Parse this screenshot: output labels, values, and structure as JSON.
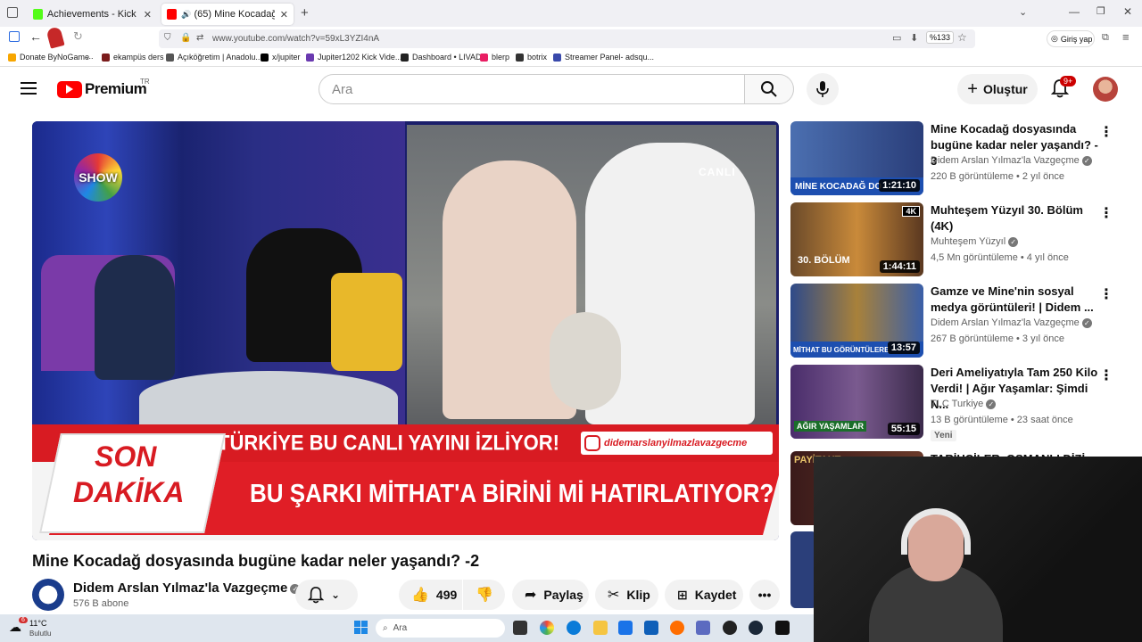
{
  "browser": {
    "tabs": [
      {
        "label": "Achievements - Kick Dashboard",
        "active": false
      },
      {
        "label": "(65) Mine Kocadağ dosyası",
        "active": true
      }
    ],
    "url": "www.youtube.com/watch?v=59xL3YZI4nA",
    "zoom": "%133",
    "signin": "Giriş yap",
    "bookmarks": [
      "Donate ByNoGame",
      "ekampüs ders",
      "Açıköğretim | Anadolu...",
      "x/jupiter",
      "Jupiter1202 Kick Vide...",
      "Dashboard • LIVAD",
      "blerp",
      "botrix",
      "Streamer Panel- adsqu..."
    ]
  },
  "youtube": {
    "logo": "Premium",
    "region": "TR",
    "search_placeholder": "Ara",
    "create_label": "Oluştur",
    "notifications": "9+"
  },
  "video": {
    "show_logo": "SHOW",
    "canli": "CANLI",
    "banner_left_1": "SON",
    "banner_left_2": "DAKİKA",
    "banner_top": "TÜRKİYE BU CANLI YAYINI İZLİYOR!",
    "banner_handle": "didemarslanyilmazlavazgecme",
    "banner_bottom": "BU ŞARKI MİTHAT'A BİRİNİ Mİ HATIRLATIYOR?",
    "title": "Mine Kocadağ dosyasında bugüne kadar neler yaşandı? -2",
    "channel": "Didem Arslan Yılmaz'la Vazgeçme",
    "subscribers": "576 B abone",
    "likes": "499",
    "share": "Paylaş",
    "clip": "Klip",
    "save": "Kaydet"
  },
  "recommendations": [
    {
      "title": "Mine Kocadağ dosyasında bugüne kadar neler yaşandı? - 3",
      "channel": "Didem Arslan Yılmaz'la Vazgeçme",
      "meta": "220 B görüntüleme • 2 yıl önce",
      "duration": "1:21:10",
      "thumb_text": "MİNE KOCADAĞ DO"
    },
    {
      "title": "Muhteşem Yüzyıl 30. Bölüm (4K)",
      "channel": "Muhteşem Yüzyıl",
      "meta": "4,5 Mn görüntüleme • 4 yıl önce",
      "duration": "1:44:11",
      "thumb_text": "30. BÖLÜM",
      "badge": "4K"
    },
    {
      "title": "Gamze ve Mine'nin sosyal medya görüntüleri! | Didem ...",
      "channel": "Didem Arslan Yılmaz'la Vazgeçme",
      "meta": "267 B görüntüleme • 3 yıl önce",
      "duration": "13:57",
      "thumb_text": "MİTHAT BU GÖRÜNTÜLERE"
    },
    {
      "title": "Deri Ameliyatıyla Tam 250 Kilo Verdi! | Ağır Yaşamlar: Şimdi N...",
      "channel": "TLC Turkiye",
      "meta": "13 B görüntüleme • 23 saat önce",
      "duration": "55:15",
      "thumb_text": "AĞIR YAŞAMLAR",
      "new_badge": "Yeni"
    },
    {
      "title": "TARİHÇİLER, OSMANLI DİZİ...",
      "thumb_text": "PAYİTAHT"
    }
  ],
  "taskbar": {
    "weather_temp": "11°C",
    "weather_desc": "Bulutlu",
    "weather_badge": "6",
    "search": "Ara"
  }
}
